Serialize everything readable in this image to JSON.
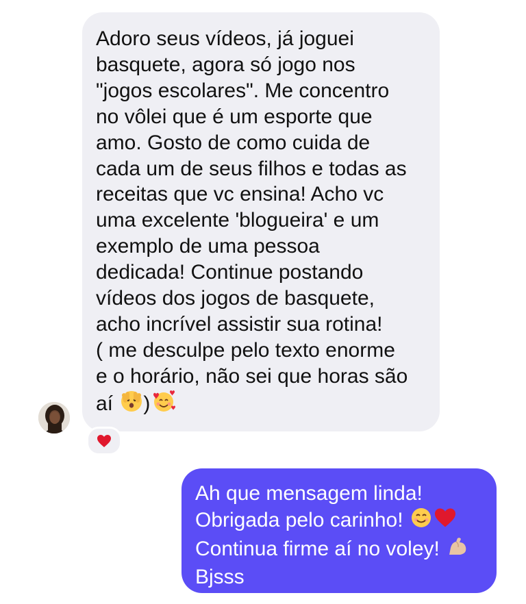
{
  "incoming_message": {
    "lines": [
      "Adoro seus vídeos, já joguei",
      "basquete, agora só jogo nos",
      "\"jogos escolares\". Me concentro",
      "no vôlei que é um esporte que",
      "amo. Gosto de como cuida de",
      "cada um de seus filhos e todas as",
      "receitas que vc ensina! Acho vc",
      "uma excelente 'blogueira' e um",
      "exemplo de uma pessoa",
      "dedicada! Continue postando",
      "vídeos dos jogos de basquete,",
      "acho incrível assistir sua rotina!",
      "( me desculpe pelo texto enorme",
      "e o horário, não sei que horas são"
    ],
    "last_line_prefix": "aí",
    "last_line_paren": ")",
    "end_emojis": [
      "peeking-face-icon",
      "smiling-face-with-hearts-icon"
    ],
    "reaction": "red-heart-icon",
    "bubble_color": "#efeff4"
  },
  "outgoing_message": {
    "lines": [
      "Ah que mensagem linda!",
      "Obrigada pelo carinho!",
      "Continua firme aí no voley!",
      "Bjsss"
    ],
    "line2_emojis": [
      "smiling-face-icon",
      "red-heart-icon"
    ],
    "line3_emoji": "flexed-biceps-icon",
    "bubble_color": "#5b4df6",
    "text_color": "#ffffff"
  }
}
